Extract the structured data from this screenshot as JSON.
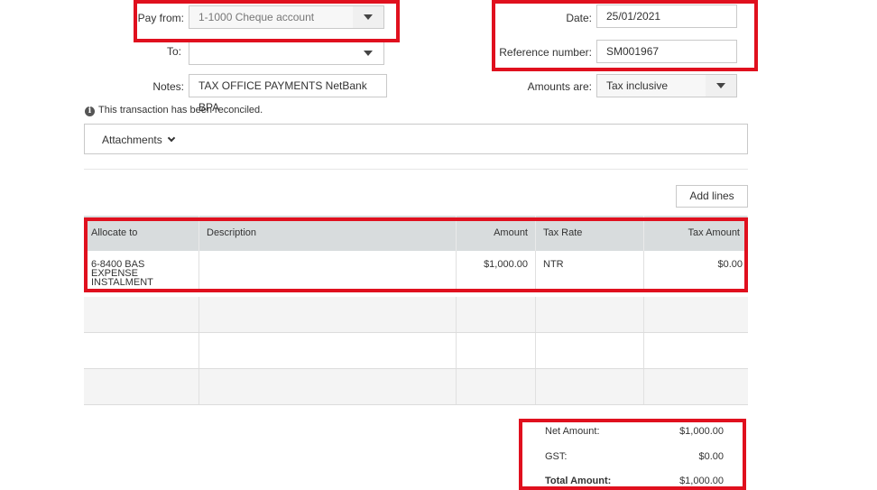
{
  "pay_from": {
    "label": "Pay from:",
    "value": "1-1000 Cheque account"
  },
  "to": {
    "label": "To:",
    "value": ""
  },
  "notes": {
    "label": "Notes:",
    "value": "TAX OFFICE PAYMENTS NetBank BPA"
  },
  "date": {
    "label": "Date:",
    "value": "25/01/2021"
  },
  "reference": {
    "label": "Reference number:",
    "value": "SM001967"
  },
  "amounts_are": {
    "label": "Amounts are:",
    "value": "Tax inclusive"
  },
  "reconciled_notice": "This transaction has been reconciled.",
  "attachments_label": "Attachments",
  "add_lines_label": "Add lines",
  "table": {
    "headers": [
      "Allocate to",
      "Description",
      "Amount",
      "Tax Rate",
      "Tax Amount"
    ],
    "rows": [
      {
        "allocate_to": "6-8400 BAS EXPENSE INSTALMENT",
        "description": "",
        "amount": "$1,000.00",
        "tax_rate": "NTR",
        "tax_amount": "$0.00"
      }
    ]
  },
  "totals": {
    "net_label": "Net Amount:",
    "net_value": "$1,000.00",
    "gst_label": "GST:",
    "gst_value": "$0.00",
    "total_label": "Total Amount:",
    "total_value": "$1,000.00"
  },
  "highlight_color": "#e0101e"
}
